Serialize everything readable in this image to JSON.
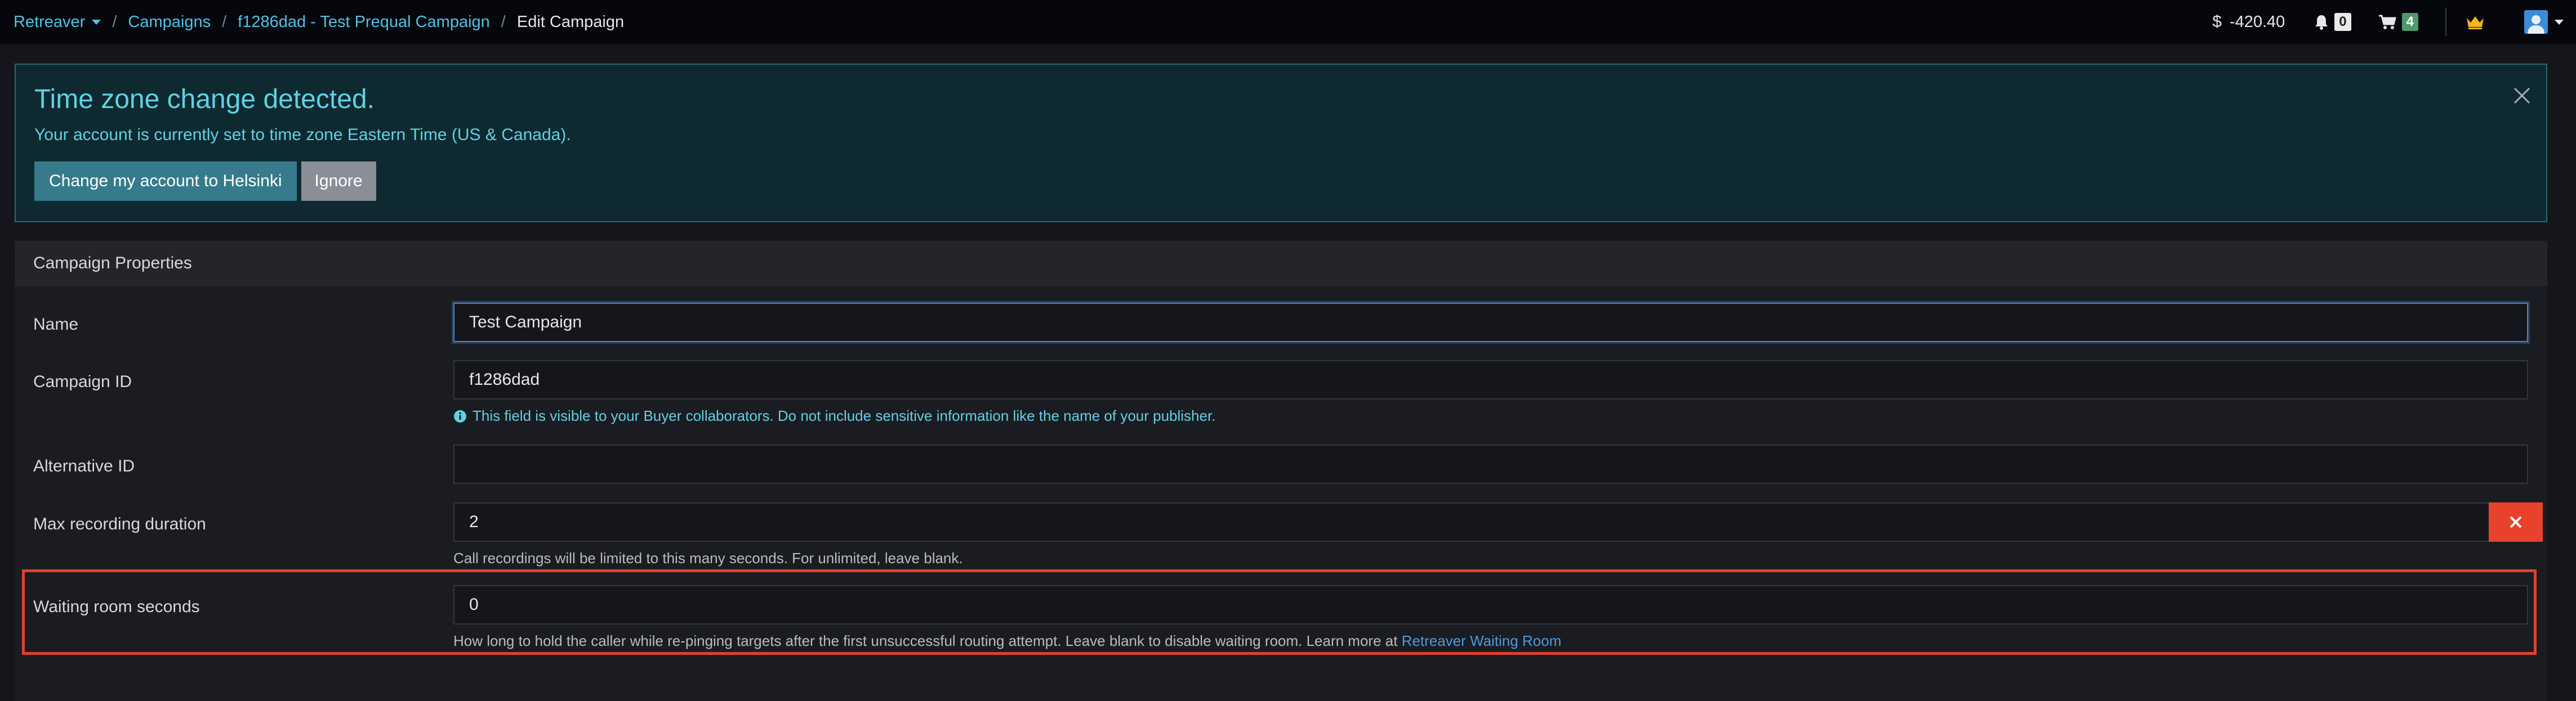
{
  "navbar": {
    "breadcrumbs": [
      {
        "label": "Retreaver"
      },
      {
        "label": "Campaigns"
      },
      {
        "label": "f1286dad - Test Prequal Campaign"
      },
      {
        "label": "Edit Campaign"
      }
    ],
    "balance_symbol": "$",
    "balance": "-420.40",
    "notifications_count": "0",
    "cart_count": "4"
  },
  "timezone_alert": {
    "title": "Time zone change detected.",
    "message": "Your account is currently set to time zone Eastern Time (US & Canada).",
    "change_button": "Change my account to Helsinki",
    "ignore_button": "Ignore"
  },
  "campaign_properties": {
    "header": "Campaign Properties",
    "name": {
      "label": "Name",
      "value": "Test Campaign"
    },
    "campaign_id": {
      "label": "Campaign ID",
      "value": "f1286dad",
      "help": "This field is visible to your Buyer collaborators. Do not include sensitive information like the name of your publisher."
    },
    "alternative_id": {
      "label": "Alternative ID",
      "value": ""
    },
    "max_recording_duration": {
      "label": "Max recording duration",
      "value": "2",
      "help": "Call recordings will be limited to this many seconds. For unlimited, leave blank."
    },
    "waiting_room_seconds": {
      "label": "Waiting room seconds",
      "value": "0",
      "help": "How long to hold the caller while re-pinging targets after the first unsuccessful routing attempt. Leave blank to disable waiting room. Learn more at ",
      "help_link": "Retreaver Waiting Room"
    }
  },
  "colors": {
    "accent": "#4fc3e1",
    "danger": "#e8412c",
    "highlight": "#e0422a"
  },
  "icons": [
    "chevron-down-icon",
    "dollar-icon",
    "bell-icon",
    "cart-icon",
    "crown-icon",
    "user-icon",
    "close-icon",
    "info-icon",
    "x-icon"
  ]
}
